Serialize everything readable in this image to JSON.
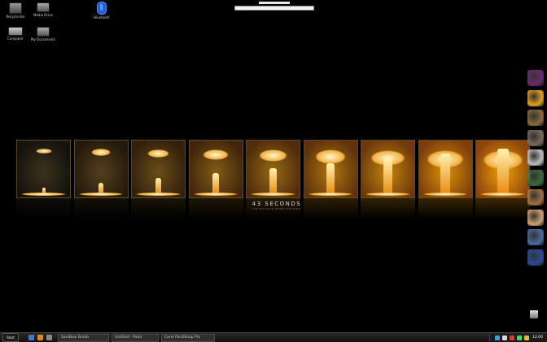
{
  "desktop": {
    "icons": [
      {
        "label": "Recycle Bin",
        "icon": "folder-icon"
      },
      {
        "label": "Media Drive",
        "icon": "drive-icon"
      },
      {
        "label": "Bluetooth",
        "icon": "bluetooth-icon"
      },
      {
        "label": "Computer",
        "icon": "laptop-icon"
      },
      {
        "label": "My Documents",
        "icon": "drive-icon"
      }
    ]
  },
  "wallpaper": {
    "title": "43 SECONDS",
    "subtitle": "THE NUCLEAR BOMB EXPLODES",
    "frame_count": 9
  },
  "game_icons": [
    {
      "name": "game-icon-1",
      "color": "#6b2a6f"
    },
    {
      "name": "game-icon-2",
      "color": "#e0a020"
    },
    {
      "name": "game-icon-3",
      "color": "#8a6a3a"
    },
    {
      "name": "game-icon-4",
      "color": "#7a6a5a"
    },
    {
      "name": "game-icon-5",
      "color": "#bdbdbd"
    },
    {
      "name": "game-icon-6",
      "color": "#3a6a3a"
    },
    {
      "name": "game-icon-7",
      "color": "#a07040"
    },
    {
      "name": "game-icon-8",
      "color": "#d0a070"
    },
    {
      "name": "game-icon-9",
      "color": "#4a6aa0"
    },
    {
      "name": "game-icon-10",
      "color": "#2a4a9a"
    }
  ],
  "taskbar": {
    "start_label": "Start",
    "tasks": [
      {
        "label": "Sandbox Bomb"
      },
      {
        "label": "Untitled - Paint"
      },
      {
        "label": "Corel PaintShop Pro"
      }
    ],
    "clock": "12:00"
  },
  "colors": {
    "background": "#000000",
    "flash": "#f2b040",
    "taskbar": "#1a1a1a"
  }
}
